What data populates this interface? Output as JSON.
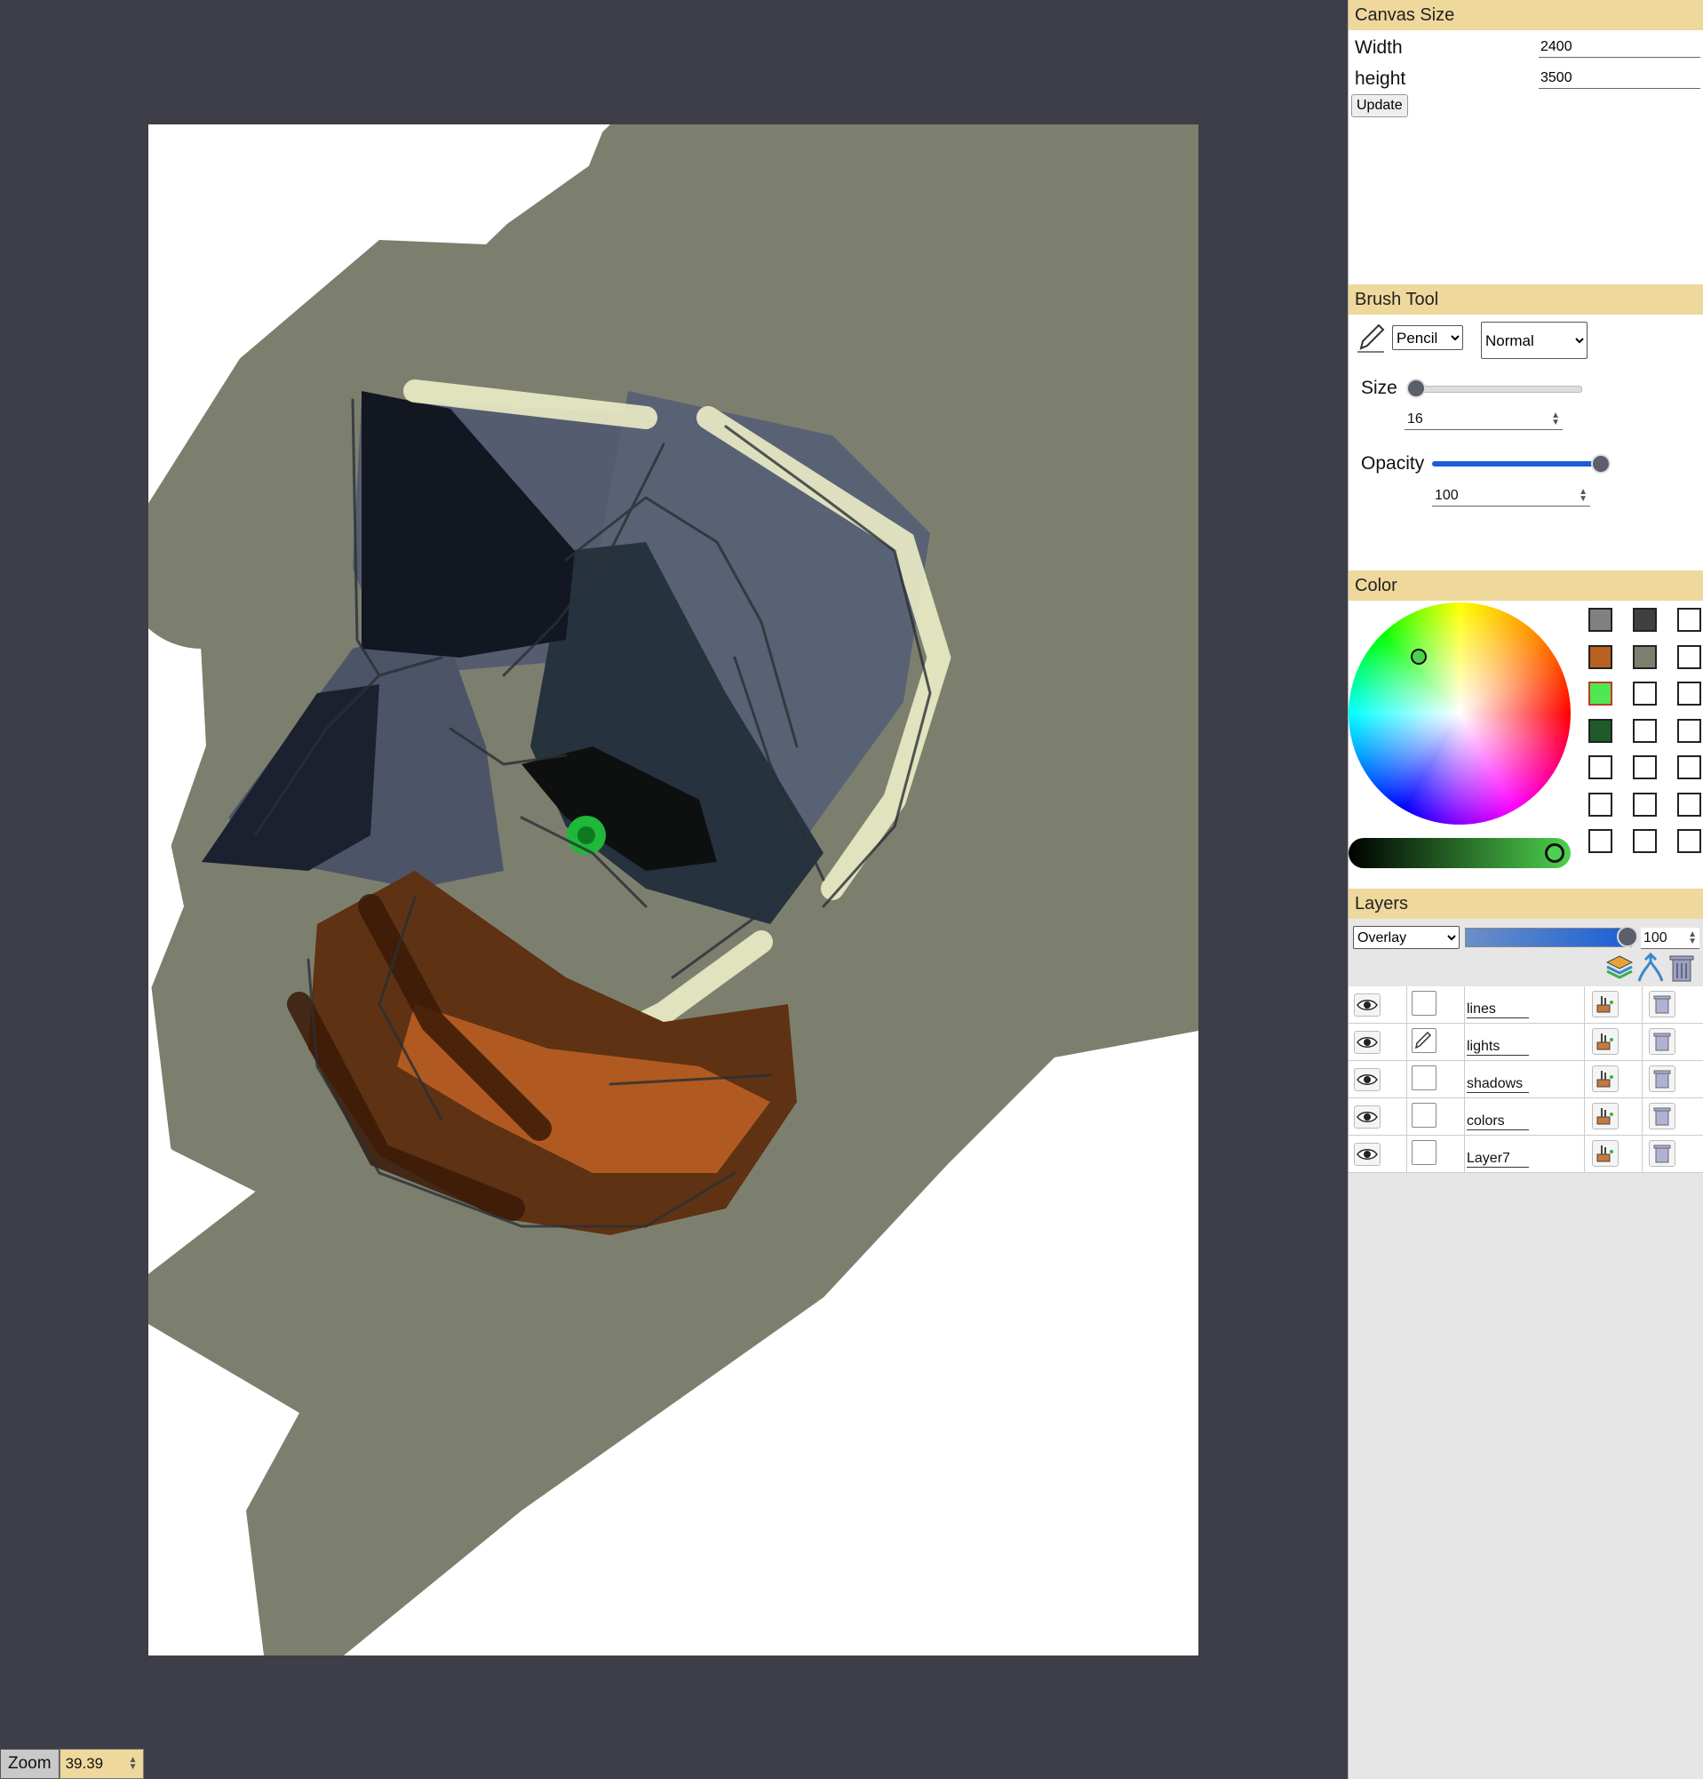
{
  "canvas_size": {
    "title": "Canvas Size",
    "width_label": "Width",
    "width_value": "2400",
    "height_label": "height",
    "height_value": "3500",
    "update_label": "Update"
  },
  "brush": {
    "title": "Brush Tool",
    "tool_selected": "Pencil",
    "mode_selected": "Normal",
    "size_label": "Size",
    "size_value": "16",
    "opacity_label": "Opacity",
    "opacity_value": "100",
    "size_fraction": 0.04,
    "opacity_fraction": 1.0
  },
  "color": {
    "title": "Color",
    "current": "#4ed14e",
    "swatches": [
      "#808080",
      "#404040",
      "#ffffff",
      "#b85f22",
      "#7d7f6e",
      "#ffffff",
      "#50e850",
      "#ffffff",
      "#ffffff",
      "#1f5a2a",
      "#ffffff",
      "#ffffff",
      "#ffffff",
      "#ffffff",
      "#ffffff",
      "#ffffff",
      "#ffffff",
      "#ffffff",
      "#ffffff",
      "#ffffff",
      "#ffffff"
    ]
  },
  "layers": {
    "title": "Layers",
    "blend_selected": "Overlay",
    "opacity_value": "100",
    "items": [
      {
        "name": "lines",
        "editing": false
      },
      {
        "name": "lights",
        "editing": true
      },
      {
        "name": "shadows",
        "editing": false
      },
      {
        "name": "colors",
        "editing": false
      },
      {
        "name": "Layer7",
        "editing": false
      }
    ]
  },
  "zoom": {
    "label": "Zoom",
    "value": "39.39"
  }
}
